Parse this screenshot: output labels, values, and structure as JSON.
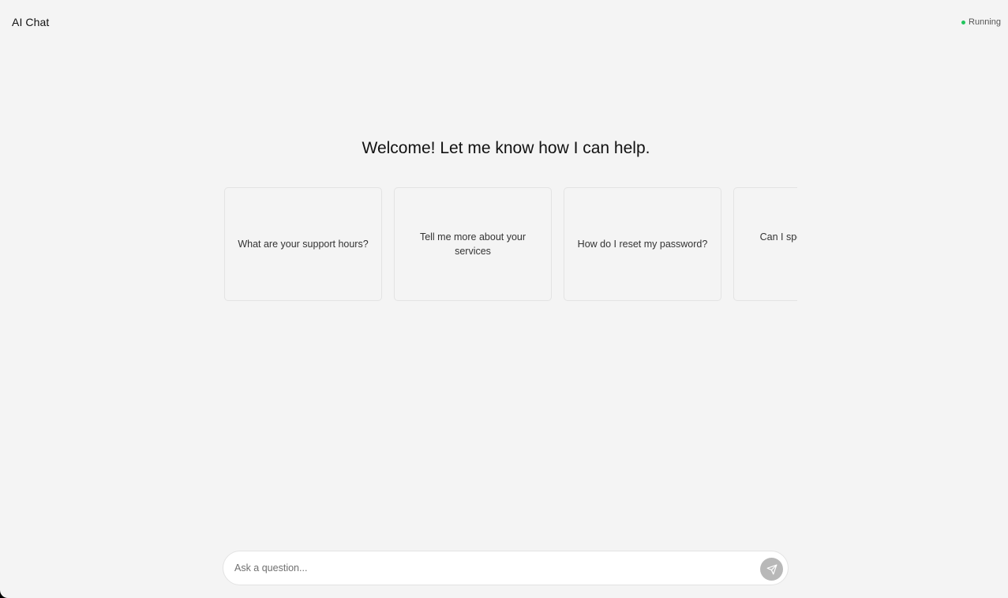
{
  "header": {
    "title": "AI Chat",
    "status": "Running"
  },
  "welcome": {
    "heading": "Welcome! Let me know how I can help."
  },
  "suggestions": [
    {
      "text": "What are your support hours?"
    },
    {
      "text": "Tell me more about your services"
    },
    {
      "text": "How do I reset my password?"
    },
    {
      "text": "Can I speak to a human agent?"
    }
  ],
  "composer": {
    "placeholder": "Ask a question...",
    "value": ""
  },
  "colors": {
    "background": "#f4f4f4",
    "status_dot": "#22c55e",
    "send_button": "#b8b8b8"
  },
  "icons": {
    "send": "send-icon",
    "status": "status-dot-icon"
  }
}
